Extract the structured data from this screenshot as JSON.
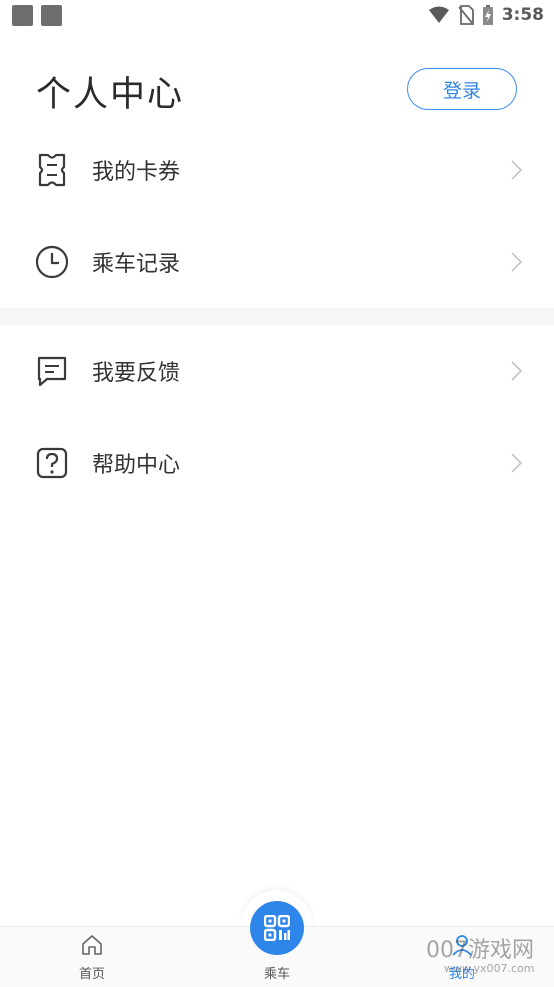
{
  "status_bar": {
    "time": "3:58"
  },
  "header": {
    "title": "个人中心",
    "login_label": "登录"
  },
  "menu": [
    {
      "label": "我的卡券",
      "icon": "ticket-icon"
    },
    {
      "label": "乘车记录",
      "icon": "clock-icon"
    },
    {
      "label": "我要反馈",
      "icon": "feedback-icon"
    },
    {
      "label": "帮助中心",
      "icon": "help-icon"
    }
  ],
  "bottom_nav": {
    "home_label": "首页",
    "ride_label": "乘车",
    "mine_label": "我的"
  },
  "watermark": {
    "text": "007游戏网",
    "sub": "www.yx007.com"
  },
  "colors": {
    "accent": "#2f86ea"
  }
}
